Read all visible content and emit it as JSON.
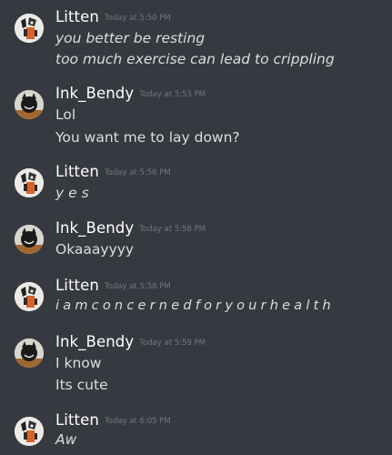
{
  "messages": [
    {
      "author": "Litten",
      "timestamp": "Today at 5:50 PM",
      "avatar_icon": "litten-avatar",
      "lines": [
        "you better be resting",
        "too much exercise can lead to crippling"
      ]
    },
    {
      "author": "Ink_Bendy",
      "timestamp": "Today at 5:53 PM",
      "avatar_icon": "bendy-avatar",
      "lines": [
        "Lol",
        "You want me to lay down?"
      ]
    },
    {
      "author": "Litten",
      "timestamp": "Today at 5:56 PM",
      "avatar_icon": "litten-avatar",
      "lines": [
        "y e s"
      ]
    },
    {
      "author": "Ink_Bendy",
      "timestamp": "Today at 5:58 PM",
      "avatar_icon": "bendy-avatar",
      "lines": [
        "Okaaayyyy"
      ]
    },
    {
      "author": "Litten",
      "timestamp": "Today at 5:58 PM",
      "avatar_icon": "litten-avatar",
      "lines": [
        "i a m c o n c e r n e d f o r y o u r h e a l t h"
      ]
    },
    {
      "author": "Ink_Bendy",
      "timestamp": "Today at 5:59 PM",
      "avatar_icon": "bendy-avatar",
      "lines": [
        "I know",
        "Its cute"
      ]
    },
    {
      "author": "Litten",
      "timestamp": "Today at 6:05 PM",
      "avatar_icon": "litten-avatar",
      "lines": [
        "Aw"
      ]
    }
  ],
  "colors": {
    "background": "#36393f",
    "username": "#ffffff",
    "timestamp": "#72767d",
    "text": "#dcddde"
  }
}
